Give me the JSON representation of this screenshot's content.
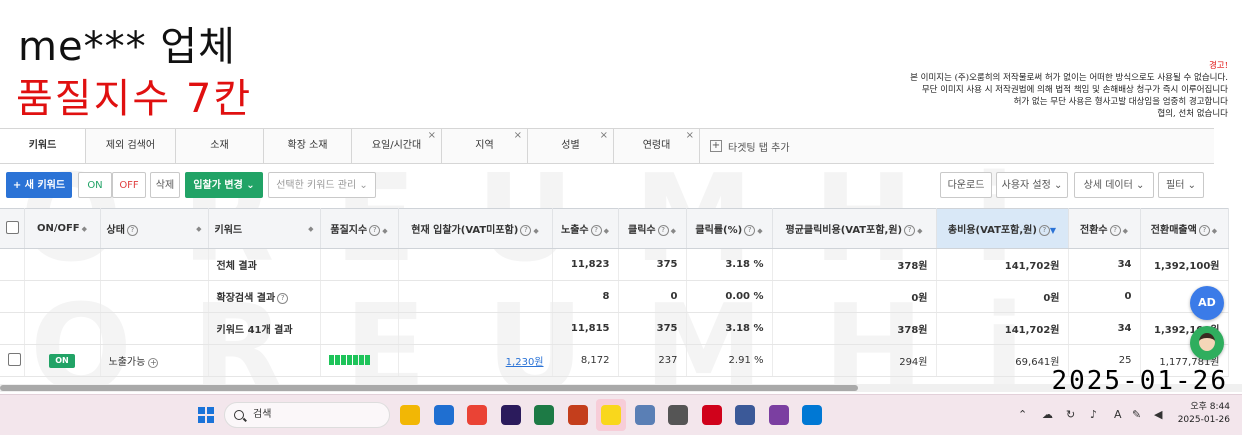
{
  "overlay": {
    "title_line1": "me*** 업체",
    "title_line2": "품질지수 7칸",
    "warning_head": "경고!",
    "warning_lines": [
      "본 이미지는 (주)오룸히의 저작물로써 허가 없이는 어떠한 방식으로도 사용될 수 없습니다.",
      "무단 이미지 사용 시 저작권법에 의해 법적 책임 및 손해배상 청구가 즉시 이루어집니다",
      "허가 없는 무단 사용은 형사고발 대상임을 엄중히 경고합니다",
      "협의, 선처 없습니다"
    ],
    "watermark": "OREUMHi",
    "date_stamp": "2025-01-26"
  },
  "tabs": [
    {
      "label": "키워드",
      "active": true,
      "closable": false
    },
    {
      "label": "제외 검색어",
      "active": false,
      "closable": false
    },
    {
      "label": "소재",
      "active": false,
      "closable": false
    },
    {
      "label": "확장 소재",
      "active": false,
      "closable": false
    },
    {
      "label": "요일/시간대",
      "active": false,
      "closable": true
    },
    {
      "label": "지역",
      "active": false,
      "closable": true
    },
    {
      "label": "성별",
      "active": false,
      "closable": true
    },
    {
      "label": "연령대",
      "active": false,
      "closable": true
    }
  ],
  "tab_add_label": "타겟팅 탭 추가",
  "toolbar": {
    "new_keyword": "+ 새 키워드",
    "on": "ON",
    "off": "OFF",
    "delete": "삭제",
    "bid_change": "입찰가 변경 ⌄",
    "manage_selected": "선택한 키워드 관리 ⌄",
    "download": "다운로드",
    "user_settings": "사용자 설정 ⌄",
    "detail_data": "상세 데이터 ⌄",
    "filter": "필터 ⌄"
  },
  "table": {
    "headers": {
      "onoff": "ON/OFF",
      "status": "상태",
      "keyword": "키워드",
      "quality": "품질지수",
      "bid": "현재 입찰가(VAT미포함)",
      "impressions": "노출수",
      "clicks": "클릭수",
      "ctr": "클릭률(%)",
      "avg_cpc": "평균클릭비용(VAT포함,원)",
      "total_cost": "총비용(VAT포함,원)",
      "conversions": "전환수",
      "conv_revenue": "전환매출액"
    },
    "summary_rows": [
      {
        "label": "전체 결과",
        "impressions": "11,823",
        "clicks": "375",
        "ctr": "3.18 %",
        "avg_cpc": "378원",
        "total_cost": "141,702원",
        "conversions": "34",
        "conv_revenue": "1,392,100원"
      },
      {
        "label": "확장검색 결과",
        "impressions": "8",
        "clicks": "0",
        "ctr": "0.00 %",
        "avg_cpc": "0원",
        "total_cost": "0원",
        "conversions": "0",
        "conv_revenue": ""
      },
      {
        "label": "키워드 41개 결과",
        "impressions": "11,815",
        "clicks": "375",
        "ctr": "3.18 %",
        "avg_cpc": "378원",
        "total_cost": "141,702원",
        "conversions": "34",
        "conv_revenue": "1,392,100원"
      }
    ],
    "data_row": {
      "toggle": "ON",
      "status": "노출가능",
      "quality_level": 7,
      "bid": "1,230원",
      "impressions": "8,172",
      "clicks": "237",
      "ctr": "2.91 %",
      "avg_cpc": "294원",
      "total_cost": "69,641원",
      "conversions": "25",
      "conv_revenue": "1,177,781원"
    }
  },
  "taskbar": {
    "search_placeholder": "검색",
    "ime": "A",
    "time": "오후 8:44",
    "date": "2025-01-26",
    "app_colors": [
      "#f2b705",
      "#1f6fd1",
      "#ea4335",
      "#2b1b5c",
      "#1d7a45",
      "#c43e1c",
      "#f9d71c",
      "#5a7fb5",
      "#555555",
      "#d0021b",
      "#3b5998",
      "#7b3fa1",
      "#0078d4"
    ]
  }
}
